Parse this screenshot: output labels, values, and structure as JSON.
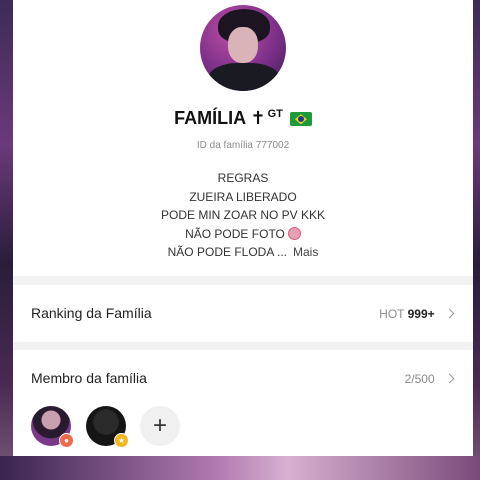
{
  "profile": {
    "family_name": "FAMÍLIA",
    "name_symbol": "✝",
    "name_tag": "GT",
    "flag_icon": "brazil-flag-icon",
    "family_id": "ID da família 777002"
  },
  "rules": {
    "lines": [
      "REGRAS",
      "ZUEIRA LIBERADO",
      "PODE MIN ZOAR NO PV KKK",
      "NÃO PODE FOTO",
      "NÃO PODE FLODA ..."
    ],
    "no_icon": "prohibited-icon",
    "more_label": "Mais"
  },
  "ranking": {
    "title": "Ranking da Família",
    "hot_label": "HOT",
    "hot_value": "999+"
  },
  "members": {
    "title": "Membro da família",
    "count": "2/500",
    "add_label": "+"
  },
  "colors": {
    "badge_owner": "#ef6a4a",
    "badge_admin": "#f2b61f"
  }
}
